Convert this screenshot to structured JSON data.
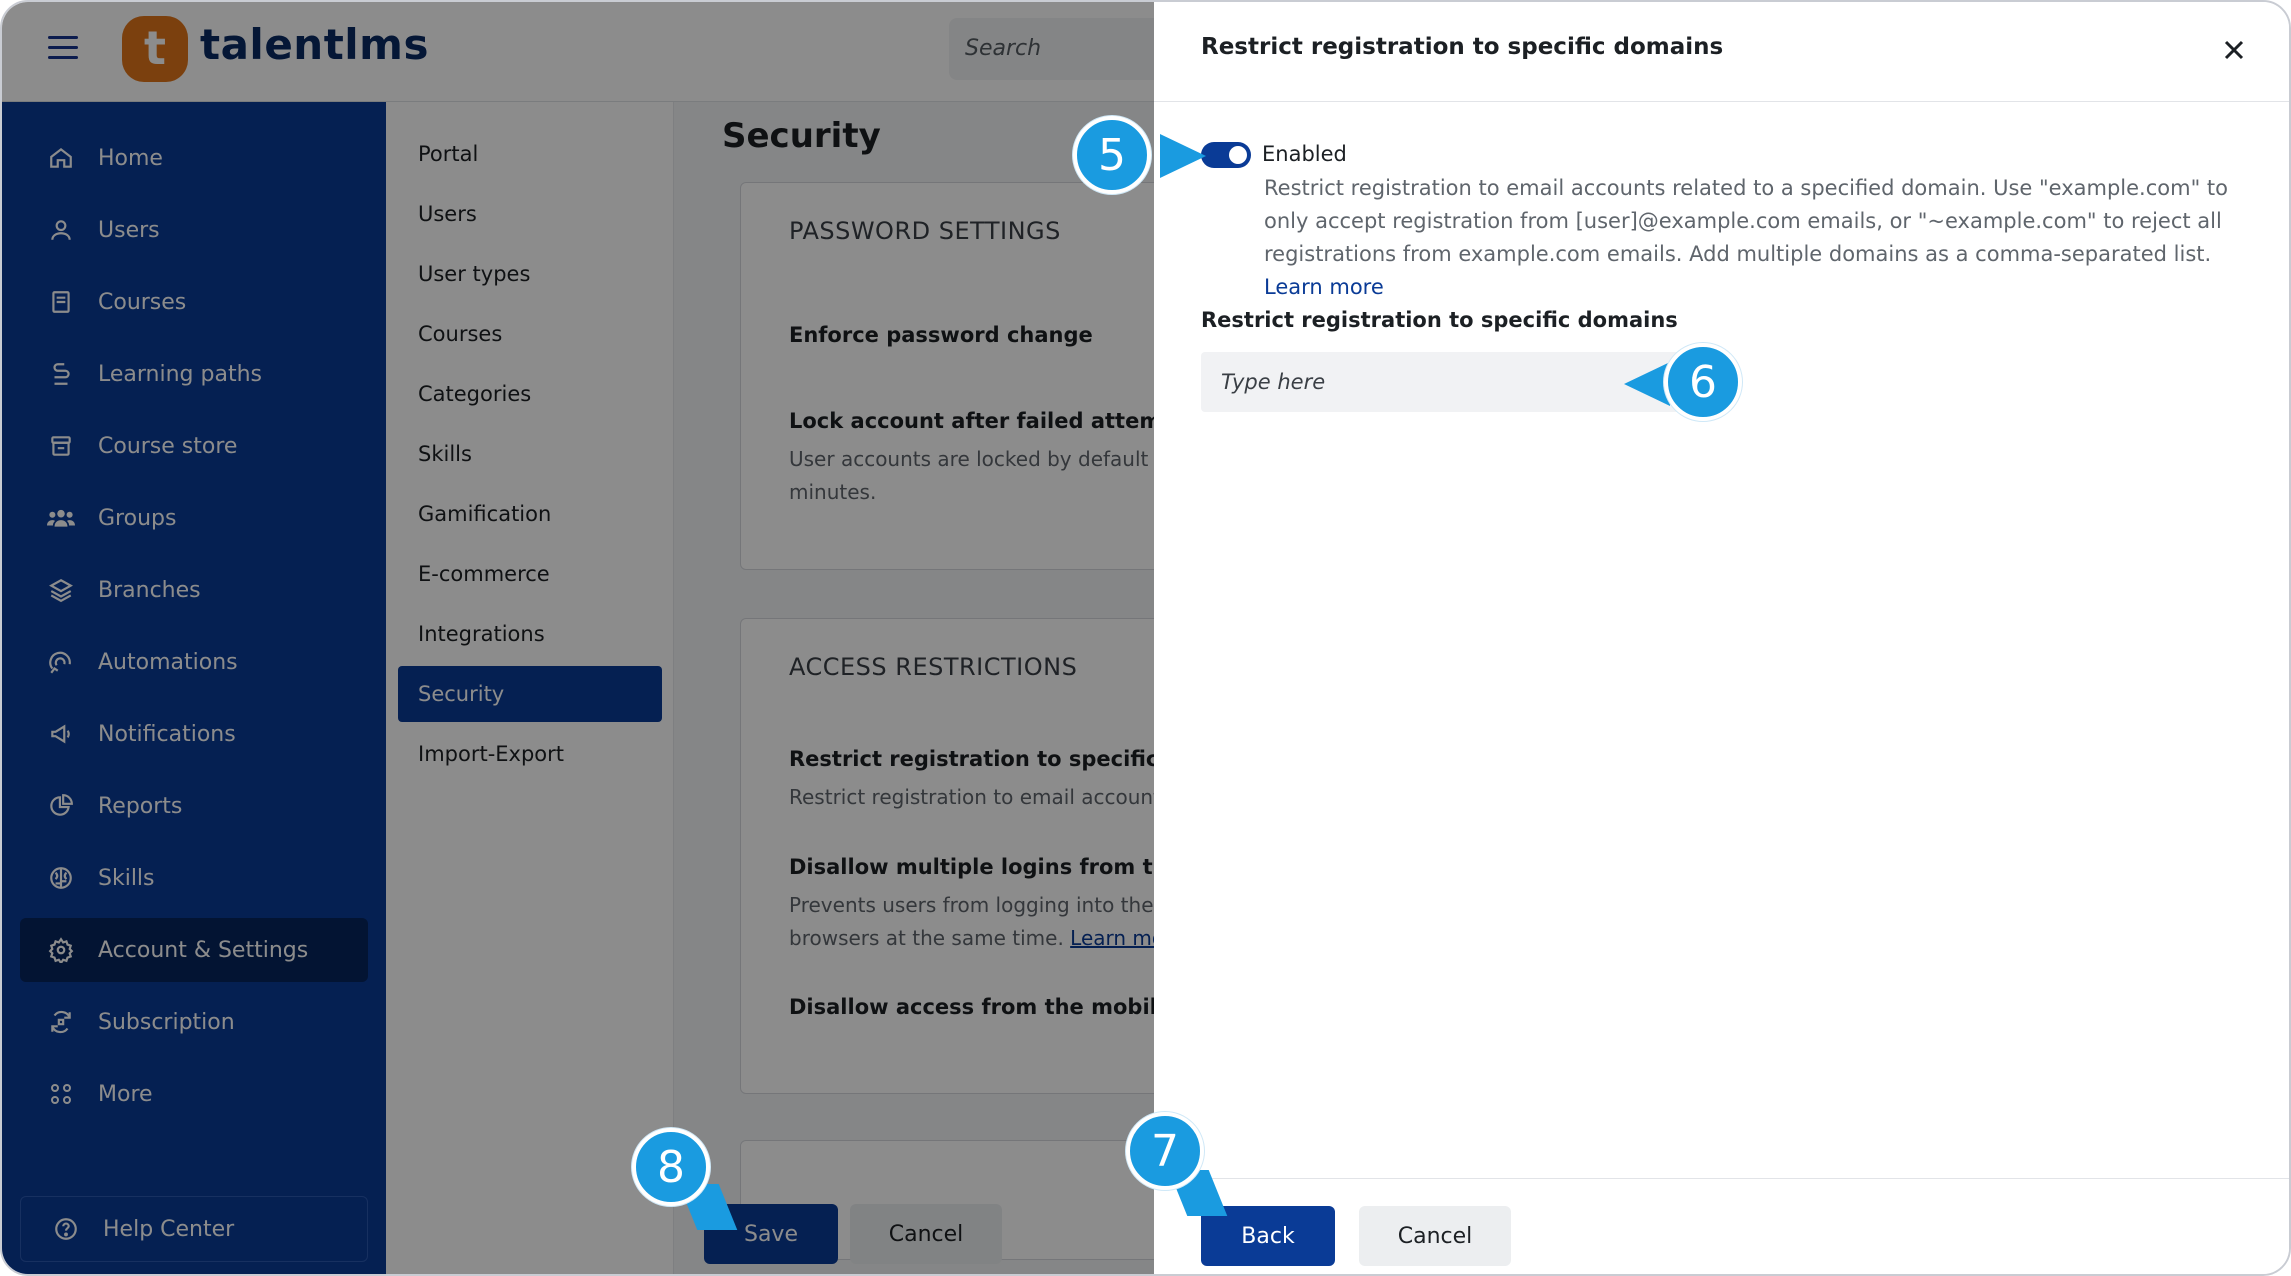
{
  "header": {
    "logo_mark": "t",
    "logo_text": "talentlms",
    "search_placeholder": "Search"
  },
  "sidebar": {
    "items": [
      {
        "label": "Home",
        "icon": "home-icon"
      },
      {
        "label": "Users",
        "icon": "user-icon"
      },
      {
        "label": "Courses",
        "icon": "book-icon"
      },
      {
        "label": "Learning paths",
        "icon": "path-icon"
      },
      {
        "label": "Course store",
        "icon": "store-icon"
      },
      {
        "label": "Groups",
        "icon": "groups-icon"
      },
      {
        "label": "Branches",
        "icon": "layers-icon"
      },
      {
        "label": "Automations",
        "icon": "automation-icon"
      },
      {
        "label": "Notifications",
        "icon": "megaphone-icon"
      },
      {
        "label": "Reports",
        "icon": "pie-chart-icon"
      },
      {
        "label": "Skills",
        "icon": "brain-icon"
      },
      {
        "label": "Account & Settings",
        "icon": "gear-icon",
        "active": true
      },
      {
        "label": "Subscription",
        "icon": "refresh-icon"
      },
      {
        "label": "More",
        "icon": "grid-icon"
      }
    ],
    "help_center": "Help Center"
  },
  "subnav": {
    "items": [
      "Portal",
      "Users",
      "User types",
      "Courses",
      "Categories",
      "Skills",
      "Gamification",
      "E-commerce",
      "Integrations",
      "Security",
      "Import-Export"
    ],
    "active": "Security"
  },
  "content": {
    "page_title": "Security",
    "password_card": {
      "title": "PASSWORD SETTINGS",
      "enforce": "Enforce password change",
      "lock_title": "Lock account after failed attempts",
      "lock_desc_1": "User accounts are locked by default a",
      "lock_desc_2": "minutes."
    },
    "access_card": {
      "title": "ACCESS RESTRICTIONS",
      "restrict_title": "Restrict registration to specific doma",
      "restrict_desc": "Restrict registration to email accounts",
      "multi_title": "Disallow multiple logins from the sar",
      "multi_desc_1": "Prevents users from logging into the s",
      "multi_desc_2": "browsers at the same time.",
      "multi_link": "Learn mor",
      "mobile_title": "Disallow access from the mobile APF"
    },
    "save_label": "Save",
    "cancel_label": "Cancel"
  },
  "drawer": {
    "title": "Restrict registration to specific domains",
    "toggle_label": "Enabled",
    "toggle_on": true,
    "description": "Restrict registration to email accounts related to a specified domain. Use \"example.com\" to only accept registration from [user]@example.com emails, or \"~example.com\" to reject all registrations from example.com emails. Add multiple domains as a comma-separated list.",
    "learn_more": "Learn more",
    "field_label": "Restrict registration to specific domains",
    "field_placeholder": "Type here",
    "field_value": "",
    "back_label": "Back",
    "cancel_label": "Cancel"
  },
  "callouts": [
    "5",
    "6",
    "7",
    "8"
  ],
  "colors": {
    "brand_blue": "#0a3b96",
    "brand_orange": "#e0761b",
    "callout_blue": "#1a9be0"
  }
}
